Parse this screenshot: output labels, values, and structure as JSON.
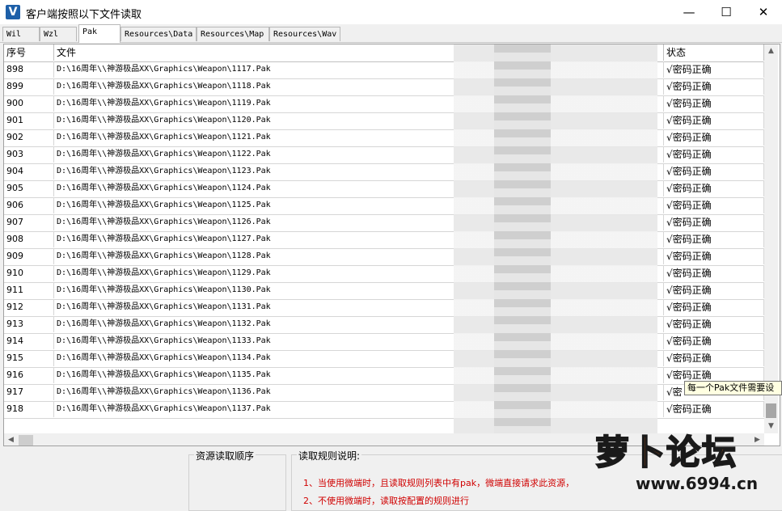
{
  "window": {
    "title": "客户端按照以下文件读取",
    "icon": "V",
    "minimize": "—",
    "maximize": "☐",
    "close": "✕"
  },
  "tabs": [
    {
      "label": "Wil"
    },
    {
      "label": "Wzl"
    },
    {
      "label": "Pak",
      "active": true
    },
    {
      "label": "Resources\\Data"
    },
    {
      "label": "Resources\\Map"
    },
    {
      "label": "Resources\\Wav"
    }
  ],
  "table": {
    "headers": {
      "index": "序号",
      "file": "文件",
      "status": "状态"
    },
    "rows": [
      {
        "index": "898",
        "file": "D:\\16周年\\\\神游极品XX\\Graphics\\Weapon\\1117.Pak",
        "status": "√密码正确"
      },
      {
        "index": "899",
        "file": "D:\\16周年\\\\神游极品XX\\Graphics\\Weapon\\1118.Pak",
        "status": "√密码正确"
      },
      {
        "index": "900",
        "file": "D:\\16周年\\\\神游极品XX\\Graphics\\Weapon\\1119.Pak",
        "status": "√密码正确"
      },
      {
        "index": "901",
        "file": "D:\\16周年\\\\神游极品XX\\Graphics\\Weapon\\1120.Pak",
        "status": "√密码正确"
      },
      {
        "index": "902",
        "file": "D:\\16周年\\\\神游极品XX\\Graphics\\Weapon\\1121.Pak",
        "status": "√密码正确"
      },
      {
        "index": "903",
        "file": "D:\\16周年\\\\神游极品XX\\Graphics\\Weapon\\1122.Pak",
        "status": "√密码正确"
      },
      {
        "index": "904",
        "file": "D:\\16周年\\\\神游极品XX\\Graphics\\Weapon\\1123.Pak",
        "status": "√密码正确"
      },
      {
        "index": "905",
        "file": "D:\\16周年\\\\神游极品XX\\Graphics\\Weapon\\1124.Pak",
        "status": "√密码正确"
      },
      {
        "index": "906",
        "file": "D:\\16周年\\\\神游极品XX\\Graphics\\Weapon\\1125.Pak",
        "status": "√密码正确"
      },
      {
        "index": "907",
        "file": "D:\\16周年\\\\神游极品XX\\Graphics\\Weapon\\1126.Pak",
        "status": "√密码正确"
      },
      {
        "index": "908",
        "file": "D:\\16周年\\\\神游极品XX\\Graphics\\Weapon\\1127.Pak",
        "status": "√密码正确"
      },
      {
        "index": "909",
        "file": "D:\\16周年\\\\神游极品XX\\Graphics\\Weapon\\1128.Pak",
        "status": "√密码正确"
      },
      {
        "index": "910",
        "file": "D:\\16周年\\\\神游极品XX\\Graphics\\Weapon\\1129.Pak",
        "status": "√密码正确"
      },
      {
        "index": "911",
        "file": "D:\\16周年\\\\神游极品XX\\Graphics\\Weapon\\1130.Pak",
        "status": "√密码正确"
      },
      {
        "index": "912",
        "file": "D:\\16周年\\\\神游极品XX\\Graphics\\Weapon\\1131.Pak",
        "status": "√密码正确"
      },
      {
        "index": "913",
        "file": "D:\\16周年\\\\神游极品XX\\Graphics\\Weapon\\1132.Pak",
        "status": "√密码正确"
      },
      {
        "index": "914",
        "file": "D:\\16周年\\\\神游极品XX\\Graphics\\Weapon\\1133.Pak",
        "status": "√密码正确"
      },
      {
        "index": "915",
        "file": "D:\\16周年\\\\神游极品XX\\Graphics\\Weapon\\1134.Pak",
        "status": "√密码正确"
      },
      {
        "index": "916",
        "file": "D:\\16周年\\\\神游极品XX\\Graphics\\Weapon\\1135.Pak",
        "status": "√密码正确"
      },
      {
        "index": "917",
        "file": "D:\\16周年\\\\神游极品XX\\Graphics\\Weapon\\1136.Pak",
        "status": "√密"
      },
      {
        "index": "918",
        "file": "D:\\16周年\\\\神游极品XX\\Graphics\\Weapon\\1137.Pak",
        "status": "√密码正确"
      }
    ]
  },
  "tooltip": "每一个Pak文件需要设",
  "bottom": {
    "order_label": "资源读取顺序",
    "rules_label": "读取规则说明:",
    "rules": [
      "1、当使用微端时，且读取规则列表中有pak，微端直接请求此资源，",
      "2、不使用微端时，读取按配置的规则进行"
    ]
  },
  "watermark": {
    "text": "萝卜论坛",
    "url": "www.6994.cn"
  },
  "colors": {
    "rule_text": "#d00000",
    "accent": "#1d5fa8",
    "watermark": "#f2701d"
  }
}
